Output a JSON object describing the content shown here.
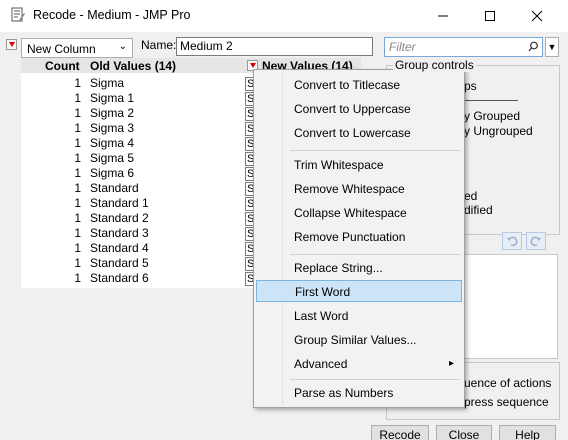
{
  "window": {
    "title": "Recode - Medium - JMP Pro",
    "minimize": "—",
    "maximize": "☐",
    "close": "✕"
  },
  "toolbar": {
    "column_mode": "New Column",
    "name_label": "Name:",
    "name_value": "Medium 2",
    "filter_placeholder": "Filter"
  },
  "table": {
    "headers": {
      "count": "Count",
      "old": "Old Values (14)",
      "new": "New Values (14)"
    },
    "rows": [
      {
        "count": "1",
        "old": "Sigma",
        "new": "S"
      },
      {
        "count": "1",
        "old": "Sigma 1",
        "new": "S"
      },
      {
        "count": "1",
        "old": "Sigma 2",
        "new": "S"
      },
      {
        "count": "1",
        "old": "Sigma 3",
        "new": "S"
      },
      {
        "count": "1",
        "old": "Sigma 4",
        "new": "S"
      },
      {
        "count": "1",
        "old": "Sigma 5",
        "new": "S"
      },
      {
        "count": "1",
        "old": "Sigma 6",
        "new": "S"
      },
      {
        "count": "1",
        "old": "Standard",
        "new": "S"
      },
      {
        "count": "1",
        "old": "Standard 1",
        "new": "S"
      },
      {
        "count": "1",
        "old": "Standard 2",
        "new": "S"
      },
      {
        "count": "1",
        "old": "Standard 3",
        "new": "S"
      },
      {
        "count": "1",
        "old": "Standard 4",
        "new": "S"
      },
      {
        "count": "1",
        "old": "Standard 5",
        "new": "S"
      },
      {
        "count": "1",
        "old": "Standard 6",
        "new": "S"
      }
    ]
  },
  "group_controls": {
    "title": "Group controls",
    "partial_1": "ps",
    "partial_2": "y Grouped",
    "partial_3": "y Ungrouped",
    "partial_4": "ed",
    "partial_5": "dified"
  },
  "sequence": {
    "partial_1": "uence of actions",
    "partial_2": "press sequence"
  },
  "buttons": {
    "recode": "Recode",
    "close": "Close",
    "help": "Help"
  },
  "menu": {
    "items": [
      "Convert to Titlecase",
      "Convert to Uppercase",
      "Convert to Lowercase",
      "Trim Whitespace",
      "Remove Whitespace",
      "Collapse Whitespace",
      "Remove Punctuation",
      "Replace String...",
      "First Word",
      "Last Word",
      "Group Similar Values...",
      "Advanced",
      "Parse as Numbers"
    ],
    "highlighted": "First Word",
    "submenu_arrow": "▸"
  },
  "colors": {
    "accent_red": "#d00000",
    "highlight": "#cce4f7",
    "highlight_border": "#7ab4e0"
  }
}
